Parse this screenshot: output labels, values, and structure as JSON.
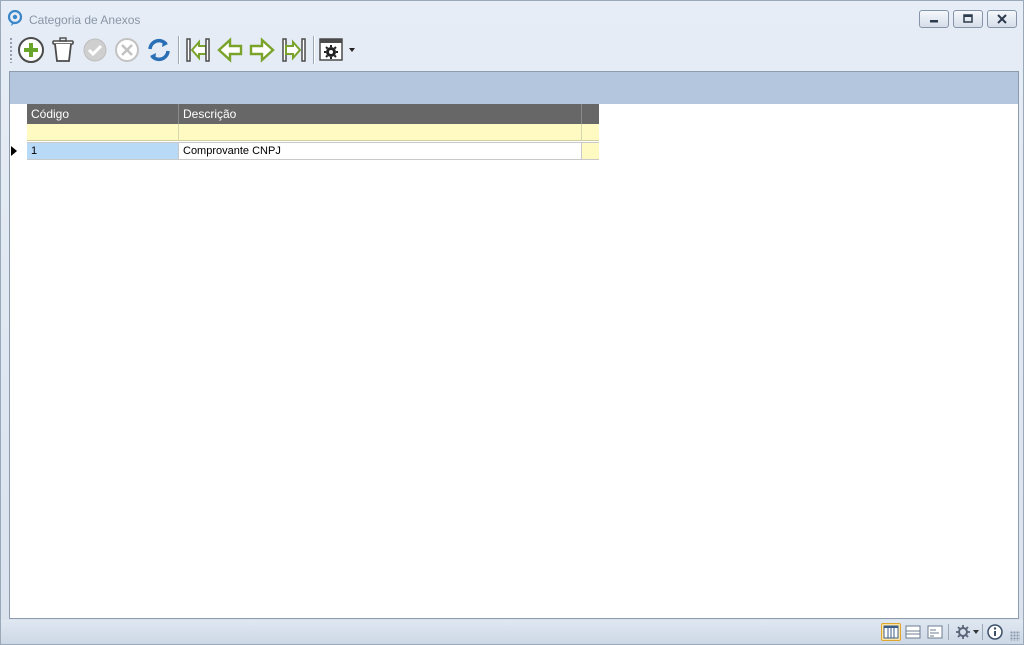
{
  "window": {
    "title": "Categoria de Anexos",
    "buttons": {
      "minimize": "minimize-icon",
      "maximize": "restore-icon",
      "close": "close-icon"
    }
  },
  "toolbar": {
    "items": [
      {
        "name": "add",
        "icon": "plus-circle-icon"
      },
      {
        "name": "delete",
        "icon": "trash-icon"
      },
      {
        "name": "confirm",
        "icon": "check-circle-icon"
      },
      {
        "name": "cancel",
        "icon": "x-circle-icon"
      },
      {
        "name": "refresh",
        "icon": "refresh-icon"
      },
      {
        "name": "first",
        "icon": "first-record-icon"
      },
      {
        "name": "previous",
        "icon": "arrow-left-icon"
      },
      {
        "name": "next",
        "icon": "arrow-right-icon"
      },
      {
        "name": "last",
        "icon": "last-record-icon"
      },
      {
        "name": "settings",
        "icon": "gear-window-icon"
      }
    ]
  },
  "grid": {
    "columns": [
      "Código",
      "Descrição"
    ],
    "rows": [
      {
        "codigo": "1",
        "descricao": "Comprovante CNPJ"
      }
    ]
  },
  "colors": {
    "group_panel": "#b3c6de",
    "header": "#676767",
    "filter_row": "#fff9c2",
    "selected_cell": "#b9daf6"
  }
}
